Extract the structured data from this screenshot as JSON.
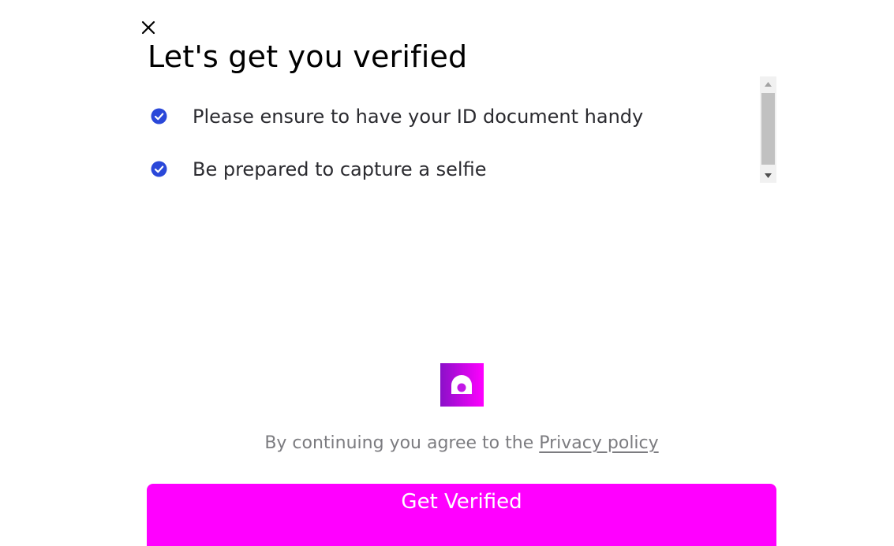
{
  "header": {
    "close_icon": "close-icon",
    "title": "Let's get you verified"
  },
  "checklist": {
    "items": [
      {
        "icon": "check-circle-icon",
        "label": "Please ensure to have your ID document handy"
      },
      {
        "icon": "check-circle-icon",
        "label": "Be prepared to capture a selfie"
      }
    ]
  },
  "logo": {
    "icon": "brand-logo-icon"
  },
  "consent": {
    "prefix": "By continuing you agree to the ",
    "link_label": "Privacy policy"
  },
  "primary_button": {
    "label": "Get Verified"
  },
  "colors": {
    "accent": "#ff00ff",
    "check": "#2a48d9",
    "logo_gradient_start": "#8a10c8",
    "logo_gradient_end": "#ff00ff",
    "muted_text": "#7c7c80",
    "scrollbar_track": "#f1f1f1",
    "scrollbar_thumb": "#c1c1c1"
  }
}
